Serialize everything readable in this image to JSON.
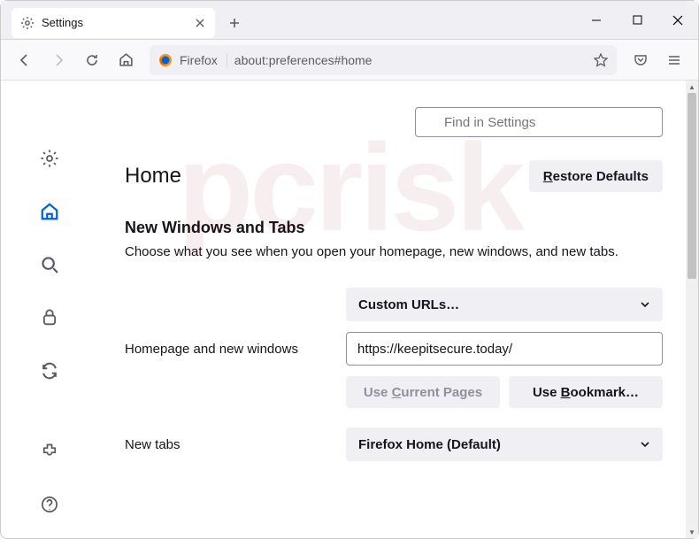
{
  "window": {
    "tab_title": "Settings",
    "url_identity": "Firefox",
    "url": "about:preferences#home"
  },
  "search": {
    "placeholder": "Find in Settings"
  },
  "page": {
    "title": "Home",
    "restore_defaults": "Restore Defaults",
    "section_title": "New Windows and Tabs",
    "section_desc": "Choose what you see when you open your homepage, new windows, and new tabs."
  },
  "homepage": {
    "label": "Homepage and new windows",
    "dropdown": "Custom URLs…",
    "url_value": "https://keepitsecure.today/",
    "use_current": "Use Current Pages",
    "use_bookmark": "Use Bookmark…"
  },
  "newtabs": {
    "label": "New tabs",
    "dropdown": "Firefox Home (Default)"
  }
}
